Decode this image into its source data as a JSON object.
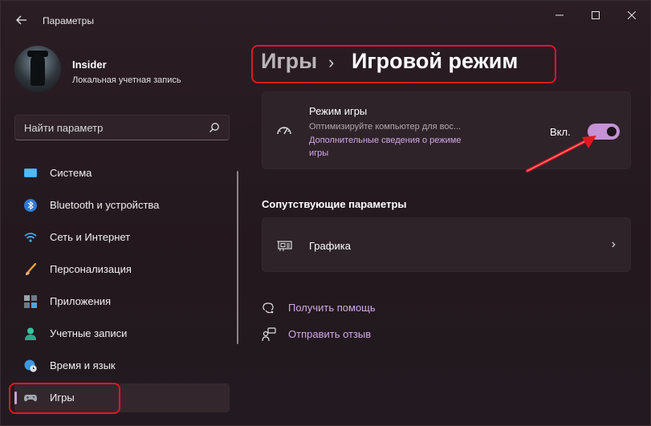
{
  "titlebar": {
    "app_title": "Параметры",
    "back_icon": "arrow-left-icon",
    "minimize_icon": "minimize-icon",
    "maximize_icon": "maximize-icon",
    "close_icon": "close-icon"
  },
  "profile": {
    "name": "Insider",
    "account_type": "Локальная учетная запись"
  },
  "search": {
    "placeholder": "Найти параметр",
    "icon": "search-icon"
  },
  "sidebar": {
    "items": [
      {
        "label": "Система",
        "icon": "monitor-icon"
      },
      {
        "label": "Bluetooth и устройства",
        "icon": "bluetooth-icon"
      },
      {
        "label": "Сеть и Интернет",
        "icon": "wifi-icon"
      },
      {
        "label": "Персонализация",
        "icon": "brush-icon"
      },
      {
        "label": "Приложения",
        "icon": "apps-icon"
      },
      {
        "label": "Учетные записи",
        "icon": "person-icon"
      },
      {
        "label": "Время и язык",
        "icon": "globe-clock-icon"
      },
      {
        "label": "Игры",
        "icon": "gamepad-icon",
        "active": true
      }
    ]
  },
  "breadcrumb": {
    "parent": "Игры",
    "separator": "›",
    "current": "Игровой режим"
  },
  "game_mode": {
    "title": "Режим игры",
    "description": "Оптимизируйте компьютер для вос...",
    "link": "Дополнительные сведения о режиме игры",
    "toggle_label": "Вкл.",
    "toggle_on": true,
    "icon": "speedometer-icon"
  },
  "related": {
    "section_title": "Сопутствующие параметры",
    "graphics_label": "Графика",
    "graphics_icon": "graphics-card-icon"
  },
  "links": {
    "help": "Получить помощь",
    "feedback": "Отправить отзыв"
  },
  "colors": {
    "accent": "#c592d6",
    "link": "#d2a8e6",
    "highlight": "#e0181f",
    "background": "#24191f"
  }
}
